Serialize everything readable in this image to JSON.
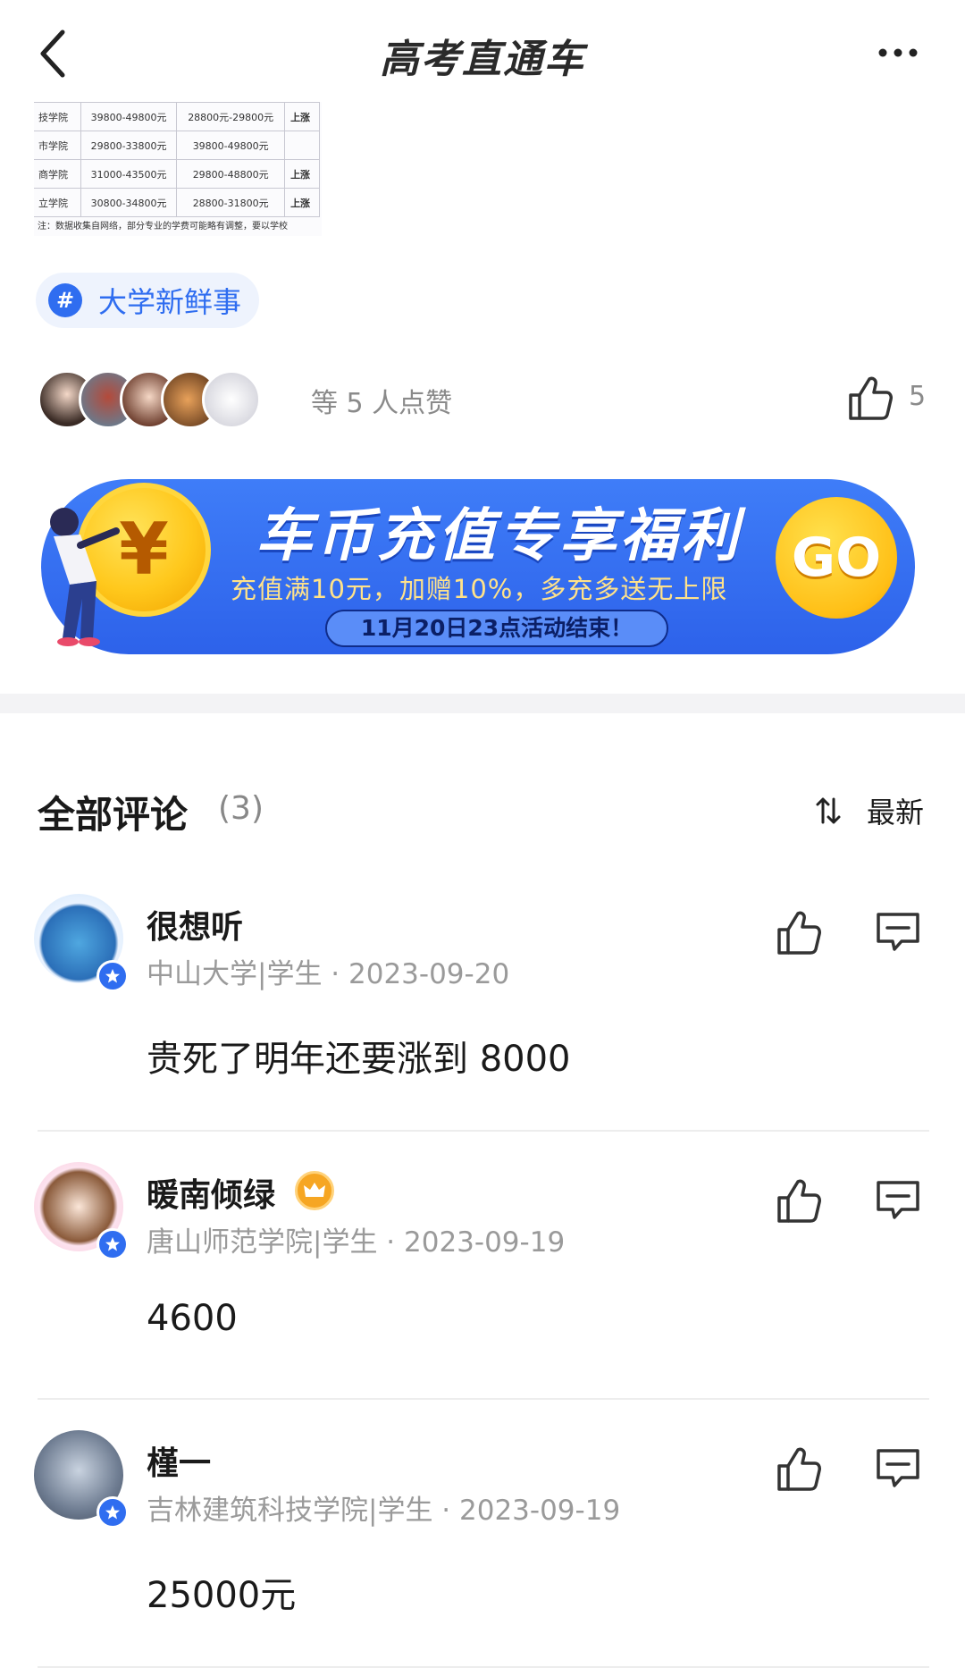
{
  "header": {
    "title": "高考直通车",
    "back_icon": "chevron-left-icon",
    "more_icon": "more-dots-icon"
  },
  "table_snippet": {
    "rows": [
      [
        "技学院",
        "39800-49800元",
        "28800元-29800元",
        "上涨"
      ],
      [
        "市学院",
        "29800-33800元",
        "39800-49800元",
        ""
      ],
      [
        "商学院",
        "31000-43500元",
        "29800-48800元",
        "上涨"
      ],
      [
        "立学院",
        "30800-34800元",
        "28800-31800元",
        "上涨"
      ]
    ],
    "note": "注：数据收集自网络，部分专业的学费可能略有调整，要以学校"
  },
  "topic": {
    "hash": "#",
    "label": "大学新鲜事"
  },
  "likes": {
    "text": "等 5 人点赞",
    "count": "5"
  },
  "banner": {
    "coin": "¥",
    "title": "车币充值专享福利",
    "subtitle": "充值满10元，加赠10%，多充多送无上限",
    "deadline": "11月20日23点活动结束！",
    "go": "GO"
  },
  "comments_section": {
    "title": "全部评论",
    "count": "(3)",
    "sort_label": "最新"
  },
  "comments": [
    {
      "name": "很想听",
      "meta": "中山大学|学生 · 2023-09-20",
      "text": "贵死了明年还要涨到 8000"
    },
    {
      "name": "暖南倾绿",
      "meta": "唐山师范学院|学生 · 2023-09-19",
      "text": "4600"
    },
    {
      "name": "槿一",
      "meta": "吉林建筑科技学院|学生 · 2023-09-19",
      "text": "25000元"
    }
  ],
  "colors": {
    "accent": "#2f6df0",
    "banner": "#3f7df8",
    "coin": "#ffc81c",
    "muted_text": "#9a9a9a"
  }
}
